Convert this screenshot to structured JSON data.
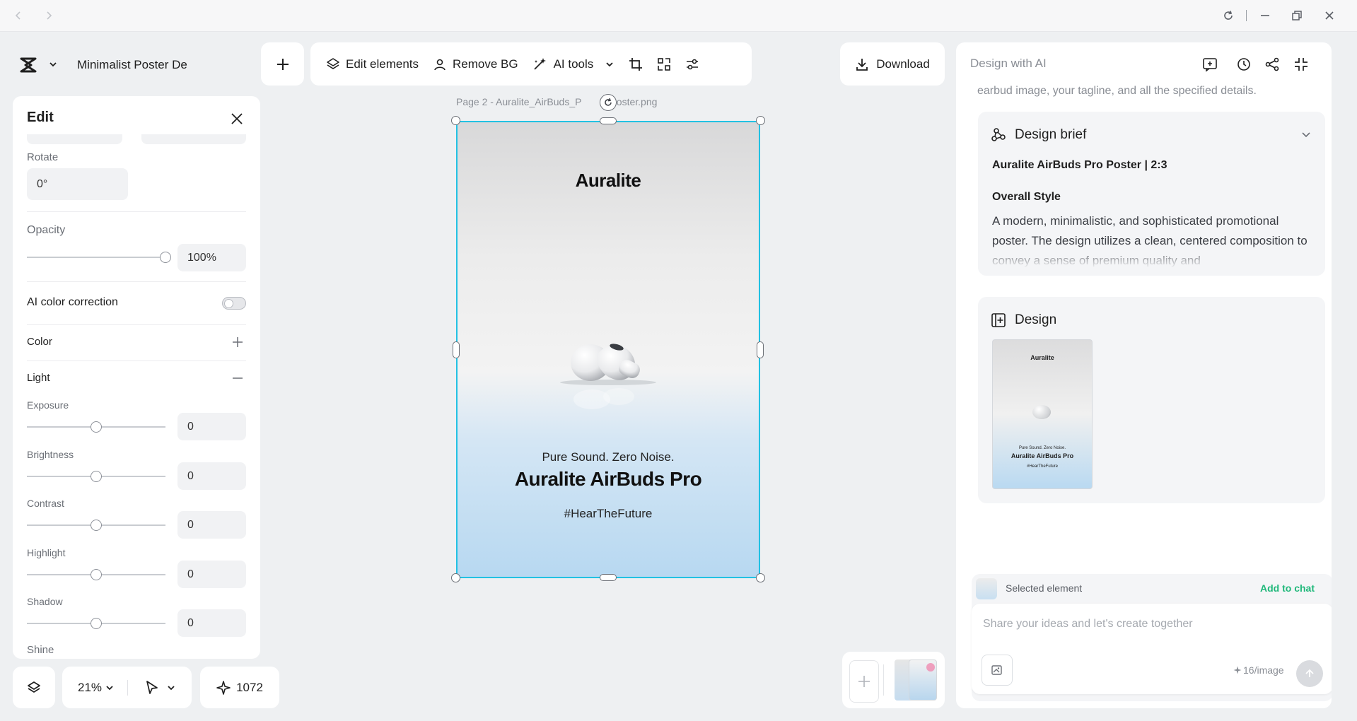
{
  "window": {
    "icons": [
      "back-arrow-icon",
      "forward-arrow-icon",
      "refresh-icon",
      "minimize-icon",
      "restore-icon",
      "close-icon"
    ]
  },
  "app": {
    "project_title": "Minimalist Poster De"
  },
  "toolbar": {
    "edit_elements": "Edit elements",
    "remove_bg": "Remove BG",
    "ai_tools": "AI tools",
    "download": "Download"
  },
  "edit_panel": {
    "title": "Edit",
    "rotate_label": "Rotate",
    "rotate_value": "0°",
    "opacity_label": "Opacity",
    "opacity_value": "100%",
    "opacity_level": 1.0,
    "ai_color_correction": "AI color correction",
    "ai_color_correction_on": false,
    "color_label": "Color",
    "light_label": "Light",
    "light_controls": [
      {
        "label": "Exposure",
        "value": "0"
      },
      {
        "label": "Brightness",
        "value": "0"
      },
      {
        "label": "Contrast",
        "value": "0"
      },
      {
        "label": "Highlight",
        "value": "0"
      },
      {
        "label": "Shadow",
        "value": "0"
      }
    ],
    "shine_label": "Shine"
  },
  "bottom_bar": {
    "zoom": "21%",
    "credits": "1072"
  },
  "canvas": {
    "page_label": "Page 2 -  Auralite_AirBuds_P",
    "page_label_suffix": "Poster.png",
    "poster": {
      "brand": "Auralite",
      "tagline": "Pure Sound. Zero Noise.",
      "product": "Auralite AirBuds Pro",
      "hashtag": "#HearTheFuture"
    }
  },
  "ai_panel": {
    "title": "Design with AI",
    "cut_text": "earbud image, your tagline, and all the specified details.",
    "brief": {
      "heading": "Design brief",
      "subtitle": "Auralite AirBuds Pro Poster | 2:3",
      "style_heading": "Overall Style",
      "style_text": "A modern, minimalistic, and sophisticated promotional poster. The design utilizes a clean, centered composition to convey a sense of premium quality and"
    },
    "design": {
      "heading": "Design"
    },
    "selected_element": "Selected element",
    "add_to_chat": "Add to chat",
    "chat_placeholder": "Share your ideas and let's create together",
    "cost": "16/image"
  },
  "colors": {
    "selection": "#22c1e3",
    "accent_green": "#1fb87a"
  }
}
